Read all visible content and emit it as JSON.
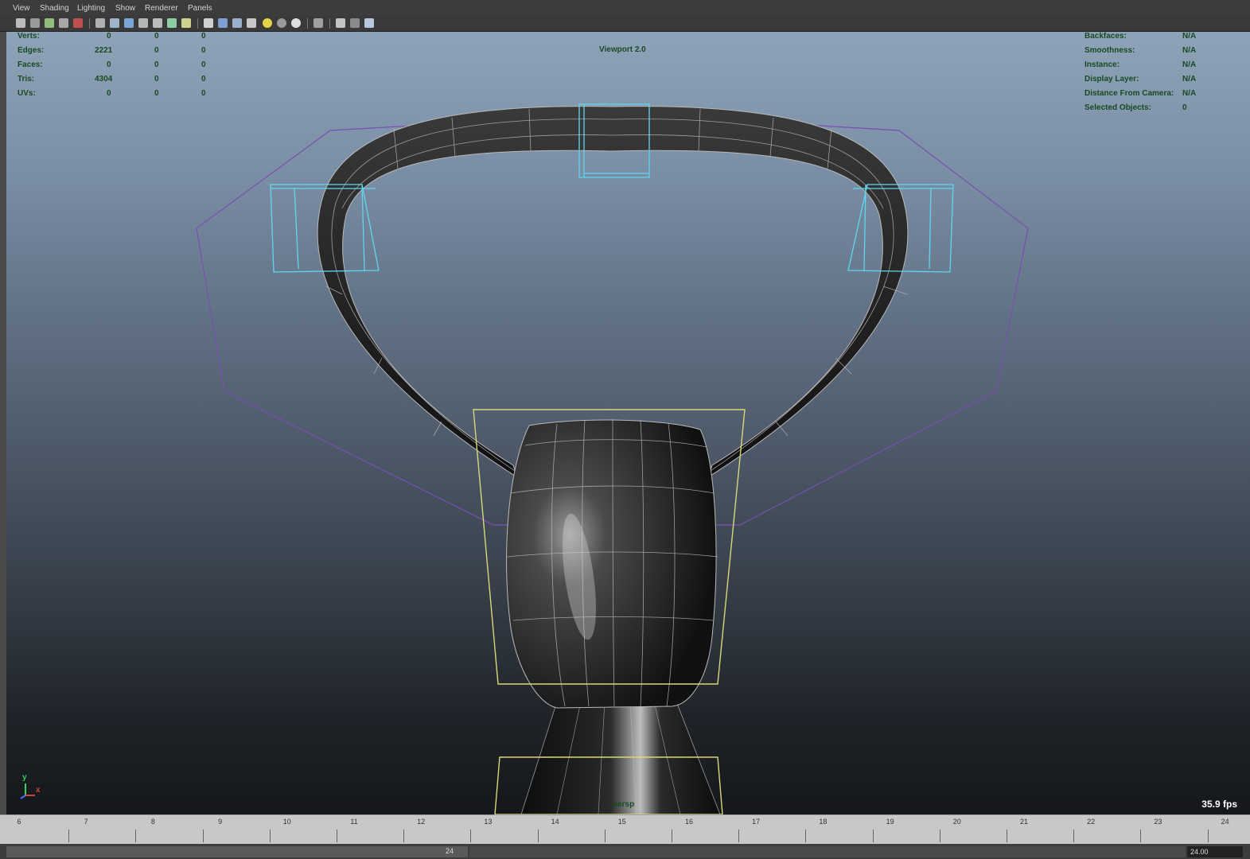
{
  "menu": {
    "items": [
      "View",
      "Shading",
      "Lighting",
      "Show",
      "Renderer",
      "Panels"
    ]
  },
  "colors": {
    "hud_text": "#184a22",
    "selection_cyan": "#5fd6ef",
    "selection_yellow": "#d9d77a",
    "wire_purple": "#7a4fb2",
    "mesh_wire": "#b9b9b9"
  },
  "hud_left": {
    "rows": [
      {
        "label": "Verts:",
        "v1": "0",
        "v2": "0",
        "v3": "0"
      },
      {
        "label": "Edges:",
        "v1": "2221",
        "v2": "0",
        "v3": "0"
      },
      {
        "label": "Faces:",
        "v1": "0",
        "v2": "0",
        "v3": "0"
      },
      {
        "label": "Tris:",
        "v1": "4304",
        "v2": "0",
        "v3": "0"
      },
      {
        "label": "UVs:",
        "v1": "0",
        "v2": "0",
        "v3": "0"
      }
    ]
  },
  "hud_center": {
    "title": "Viewport 2.0"
  },
  "hud_right": {
    "rows": [
      {
        "label": "Backfaces:",
        "value": "N/A"
      },
      {
        "label": "Smoothness:",
        "value": "N/A"
      },
      {
        "label": "Instance:",
        "value": "N/A"
      },
      {
        "label": "Display Layer:",
        "value": "N/A"
      },
      {
        "label": "Distance From Camera:",
        "value": "N/A"
      },
      {
        "label": "Selected Objects:",
        "value": "0"
      }
    ]
  },
  "camera": {
    "name": "persp"
  },
  "fps": "35.9 fps",
  "axis": {
    "y": "y",
    "x": "x"
  },
  "timeline": {
    "ticks": [
      "6",
      "7",
      "8",
      "9",
      "10",
      "11",
      "12",
      "13",
      "14",
      "15",
      "16",
      "17",
      "18",
      "19",
      "20",
      "21",
      "22",
      "23",
      "24"
    ]
  },
  "range": {
    "current": "24",
    "end_field": "24.00"
  }
}
